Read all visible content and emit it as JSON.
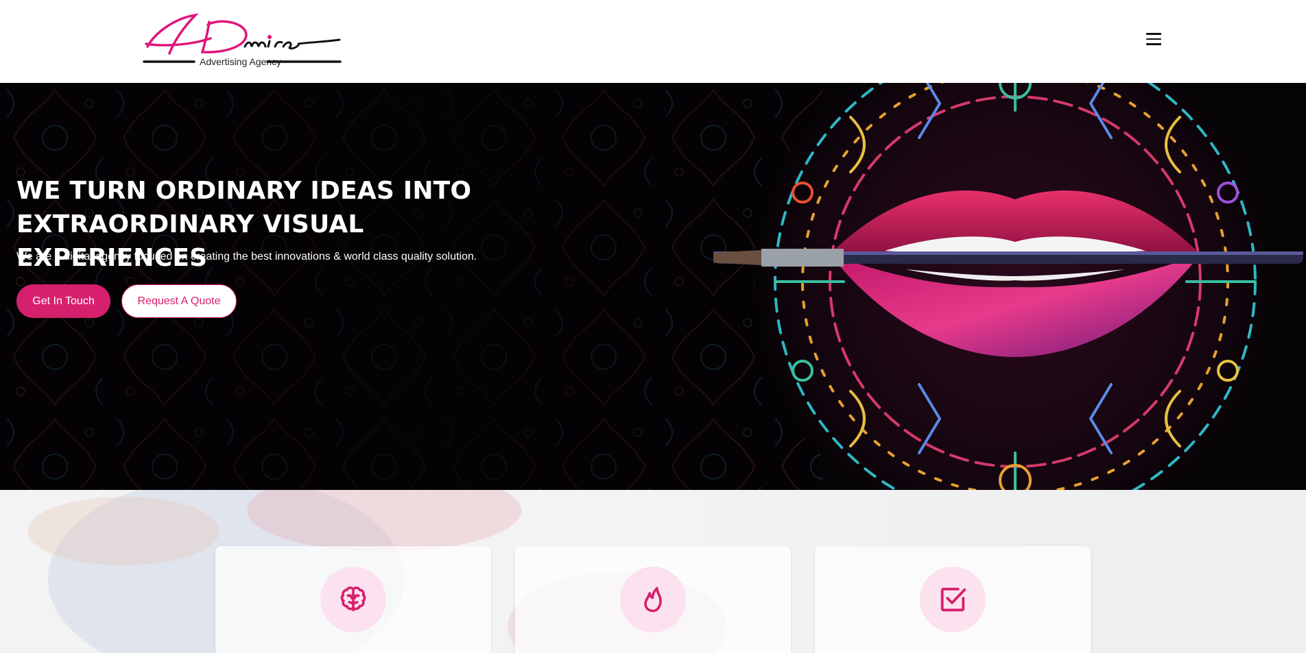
{
  "header": {
    "logo_script": "ADmire",
    "logo_tagline": "Advertising Agency",
    "menu_icon": "hamburger-icon"
  },
  "hero": {
    "title_line1": "WE TURN ORDINARY IDEAS INTO",
    "title_line2": "EXTRAORDINARY VISUAL EXPERIENCES",
    "subtitle": "We are a digital agency focused on creating the best innovations & world class quality solution.",
    "primary_button": "Get In Touch",
    "secondary_button": "Request A Quote"
  },
  "features": {
    "cards": [
      {
        "icon": "brain-icon"
      },
      {
        "icon": "flame-icon"
      },
      {
        "icon": "checkbox-icon"
      }
    ]
  },
  "colors": {
    "accent": "#d6206e",
    "icon_bg": "#fbe2ee",
    "hero_bg": "#050306"
  }
}
